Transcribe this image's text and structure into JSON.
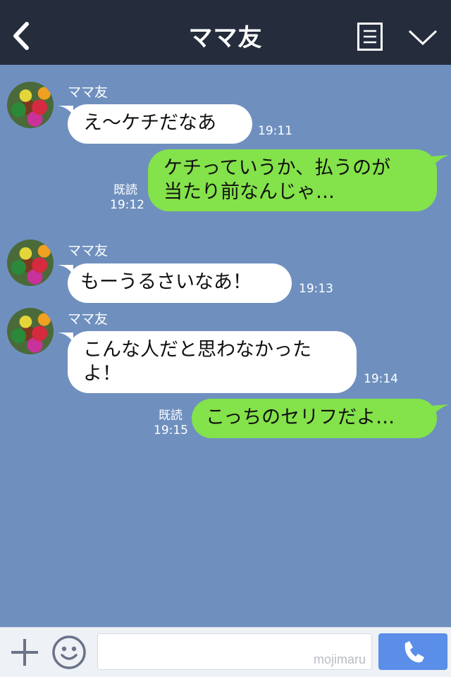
{
  "header": {
    "title": "ママ友"
  },
  "messages": [
    {
      "sender": "ママ友",
      "text": "え〜ケチだなあ",
      "time": "19:11"
    },
    {
      "text_line1": "ケチっていうか、払うのが",
      "text_line2": "当たり前なんじゃ…",
      "read": "既読",
      "time": "19:12"
    },
    {
      "sender": "ママ友",
      "text": "もーうるさいなあ！",
      "time": "19:13"
    },
    {
      "sender": "ママ友",
      "text_line1": "こんな人だと思わなかった",
      "text_line2": "よ！",
      "time": "19:14"
    },
    {
      "text": "こっちのセリフだよ…",
      "read": "既読",
      "time": "19:15"
    }
  ],
  "input": {
    "watermark": "mojimaru"
  },
  "colors": {
    "header": "#252d3d",
    "background": "#6f90bf",
    "incoming": "#ffffff",
    "outgoing": "#84e24a",
    "call": "#5a8ee8"
  },
  "icons": [
    "back-icon",
    "menu-icon",
    "chevron-down-icon",
    "plus-icon",
    "emoji-icon",
    "phone-icon"
  ]
}
